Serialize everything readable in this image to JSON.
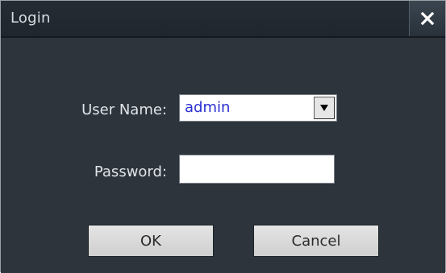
{
  "window": {
    "title": "Login",
    "close_label": "×"
  },
  "form": {
    "username_label": "User Name:",
    "username_value": "admin",
    "password_label": "Password:",
    "password_value": ""
  },
  "buttons": {
    "ok_label": "OK",
    "cancel_label": "Cancel"
  },
  "colors": {
    "titlebar": "#222930",
    "body": "#2d343c",
    "select_text": "#2a2fd2"
  },
  "icons": {
    "close": "close-icon",
    "dropdown": "chevron-down-icon"
  }
}
